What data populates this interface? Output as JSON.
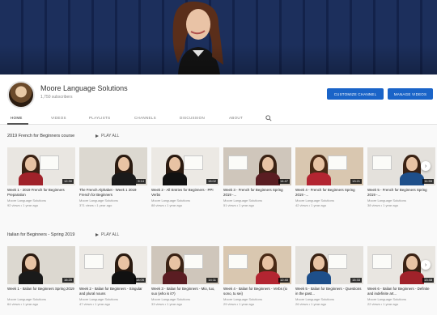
{
  "channel": {
    "name": "Moore Language Solutions",
    "subscribers": "1,750 subscribers",
    "customize_label": "CUSTOMIZE CHANNEL",
    "manage_label": "MANAGE VIDEOS"
  },
  "tabs": [
    "HOME",
    "VIDEOS",
    "PLAYLISTS",
    "CHANNELS",
    "DISCUSSION",
    "ABOUT"
  ],
  "colors": {
    "accent": "#1a64c8",
    "banner": "#1c2f5c"
  },
  "sections": [
    {
      "title": "2019 French for Beginners course",
      "play_all": "PLAY ALL",
      "videos": [
        {
          "title": "Week 1 - 2019 French for Beginners Preparation",
          "channel": "Moore Language Solutions",
          "meta": "92 views • 1 year ago",
          "duration": "12:30"
        },
        {
          "title": "The French Alphabet - Week 1 2019 French for Beginners",
          "channel": "Moore Language Solutions",
          "meta": "371 views • 1 year ago",
          "duration": "9:14"
        },
        {
          "title": "Week 2 - All Entries for Beginners - PPI Verbs",
          "channel": "Moore Language Solutions",
          "meta": "88 views • 1 year ago",
          "duration": "15:02"
        },
        {
          "title": "Week 3 - French for Beginners Spring 2019 -...",
          "channel": "Moore Language Solutions",
          "meta": "51 views • 1 year ago",
          "duration": "14:47"
        },
        {
          "title": "Week 4 - French for Beginners Spring 2019 -...",
          "channel": "Moore Language Solutions",
          "meta": "42 views • 1 year ago",
          "duration": "13:21"
        },
        {
          "title": "Week 5 - French for Beginners Spring 2019 -...",
          "channel": "Moore Language Solutions",
          "meta": "38 views • 1 year ago",
          "duration": "11:55"
        }
      ]
    },
    {
      "title": "Italian for Beginners - Spring 2019",
      "play_all": "PLAY ALL",
      "videos": [
        {
          "title": "Week 1 - Italian for Beginners Spring 2019",
          "channel": "Moore Language Solutions",
          "meta": "64 views • 1 year ago",
          "duration": "16:20"
        },
        {
          "title": "Week 2 - Italian for Beginners - Singular and plural nouns",
          "channel": "Moore Language Solutions",
          "meta": "47 views • 1 year ago",
          "duration": "18:05"
        },
        {
          "title": "Week 3 - Italian for Beginners - Mio, tuo, suo (who is it?)",
          "channel": "Moore Language Solutions",
          "meta": "33 views • 1 year ago",
          "duration": "14:11"
        },
        {
          "title": "Week 4 - Italian for Beginners - Verbs (io sono, tu sei)",
          "channel": "Moore Language Solutions",
          "meta": "29 views • 1 year ago",
          "duration": "12:40"
        },
        {
          "title": "Week 5 - Italian for Beginners - Questions in the past...",
          "channel": "Moore Language Solutions",
          "meta": "26 views • 1 year ago",
          "duration": "15:33"
        },
        {
          "title": "Week 6 - Italian for Beginners - Definite and indefinite art...",
          "channel": "Moore Language Solutions",
          "meta": "22 views • 1 year ago",
          "duration": "13:48"
        }
      ]
    }
  ]
}
